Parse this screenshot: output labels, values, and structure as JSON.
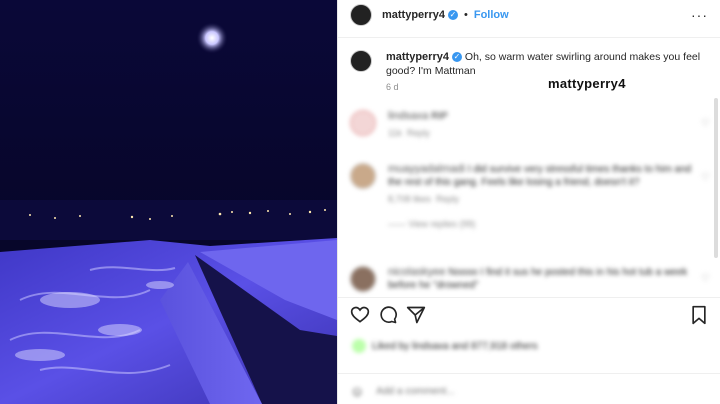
{
  "header": {
    "username": "mattyperry4",
    "separator": "•",
    "follow_label": "Follow",
    "more_icon": "more-horizontal-icon"
  },
  "caption": {
    "username": "mattyperry4",
    "text": "Oh, so warm water swirling around makes you feel good? I'm Mattman",
    "time": "6 d"
  },
  "watermark": "mattyperry4",
  "comments": [
    {
      "user": "lindsaxa",
      "text": "RIP",
      "meta_likes": "11k",
      "meta_reply": "Reply"
    },
    {
      "user": "muayyadalmadi",
      "text": "I did survive very stressful times thanks to him and the rest of this gang. Feels like losing a friend, doesn't it?",
      "meta_likes": "8,708 likes",
      "meta_reply": "Reply",
      "view_replies": "View replies (99)"
    },
    {
      "user": "nicolaskyee",
      "text": "Noooo I find it sus he posted this in his hot tub a week before he \"drowned\"",
      "meta_likes": "",
      "meta_reply": ""
    }
  ],
  "actions": {
    "like_icon": "heart-icon",
    "comment_icon": "comment-icon",
    "share_icon": "send-icon",
    "save_icon": "bookmark-icon"
  },
  "likes_text": "Liked by lindsaxa and 877,918 others",
  "add_comment": {
    "placeholder": "Add a comment..."
  },
  "emoji_icon": "emoji-icon",
  "colors": {
    "accent": "#3897f0",
    "photo_tint": "#4a3fd6"
  }
}
